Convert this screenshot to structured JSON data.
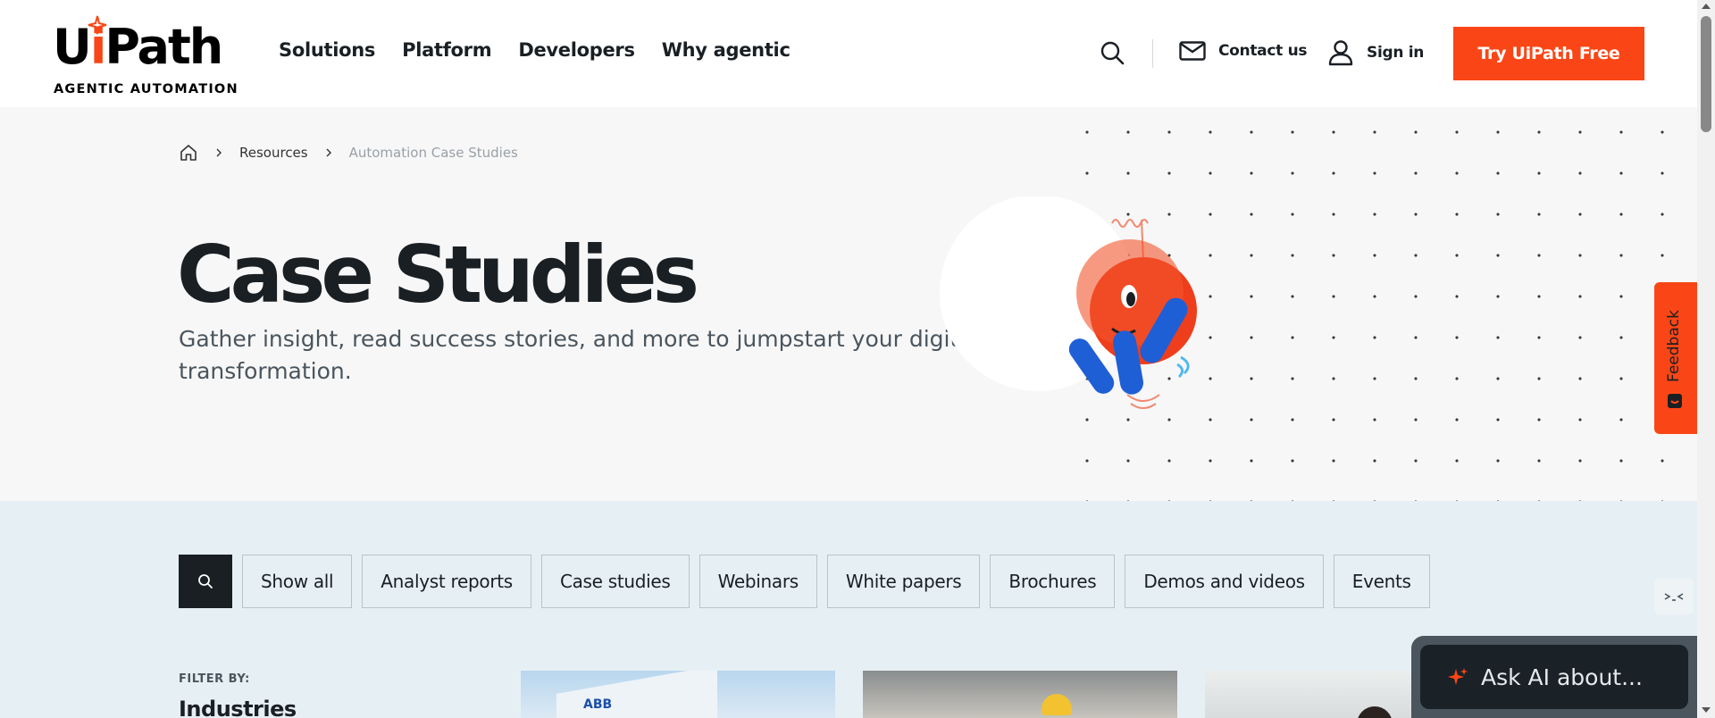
{
  "brand": {
    "name_pre": "U",
    "name_i": "i",
    "name_post": "Path",
    "tagline": "AGENTIC AUTOMATION",
    "accent_color": "#fa4616",
    "dark_color": "#1a1f24"
  },
  "nav": {
    "items": [
      {
        "label": "Solutions"
      },
      {
        "label": "Platform"
      },
      {
        "label": "Developers"
      },
      {
        "label": "Why agentic"
      }
    ],
    "search_icon": "search-icon",
    "contact_label": "Contact us",
    "signin_label": "Sign in",
    "cta_label": "Try UiPath Free"
  },
  "breadcrumb": {
    "items": [
      {
        "label": "Resources"
      }
    ],
    "current": "Automation Case Studies"
  },
  "hero": {
    "title": "Case Studies",
    "subtitle": "Gather insight, read success stories, and more to jumpstart your digital transformation."
  },
  "feedback": {
    "label": "Feedback"
  },
  "filters": {
    "chips": [
      {
        "label": "Show all"
      },
      {
        "label": "Analyst reports"
      },
      {
        "label": "Case studies"
      },
      {
        "label": "Webinars"
      },
      {
        "label": "White papers"
      },
      {
        "label": "Brochures"
      },
      {
        "label": "Demos and videos"
      },
      {
        "label": "Events"
      }
    ],
    "filter_by": "FILTER BY:",
    "industries": "Industries"
  },
  "cards": [
    {
      "logo_text": "ABB"
    }
  ],
  "ask_ai": {
    "label": "Ask AI about..."
  }
}
